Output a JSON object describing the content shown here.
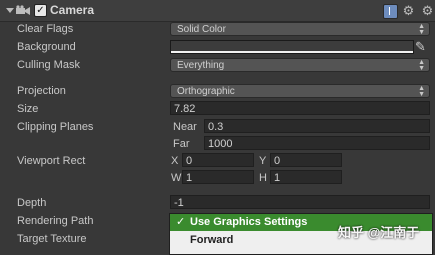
{
  "header": {
    "title": "Camera",
    "enabled_mark": "✓"
  },
  "properties": {
    "clear_flags": {
      "label": "Clear Flags",
      "value": "Solid Color"
    },
    "background": {
      "label": "Background",
      "color": "#3c3c3c"
    },
    "culling_mask": {
      "label": "Culling Mask",
      "value": "Everything"
    },
    "projection": {
      "label": "Projection",
      "value": "Orthographic"
    },
    "size": {
      "label": "Size",
      "value": "7.82"
    },
    "clipping_planes": {
      "label": "Clipping Planes",
      "near_label": "Near",
      "near_value": "0.3",
      "far_label": "Far",
      "far_value": "1000"
    },
    "viewport_rect": {
      "label": "Viewport Rect",
      "x_label": "X",
      "x_value": "0",
      "y_label": "Y",
      "y_value": "0",
      "w_label": "W",
      "w_value": "1",
      "h_label": "H",
      "h_value": "1"
    },
    "depth": {
      "label": "Depth",
      "value": "-1"
    },
    "rendering_path": {
      "label": "Rendering Path"
    },
    "target_texture": {
      "label": "Target Texture"
    }
  },
  "rendering_path_popup": {
    "options": [
      {
        "label": "Use Graphics Settings",
        "selected": true,
        "check": "✓"
      },
      {
        "label": "Forward",
        "selected": false
      }
    ]
  },
  "watermark": "知乎 @江南于",
  "colors": {
    "panel": "#383838",
    "selected": "#3a8b2e",
    "popup": "#efefef"
  }
}
